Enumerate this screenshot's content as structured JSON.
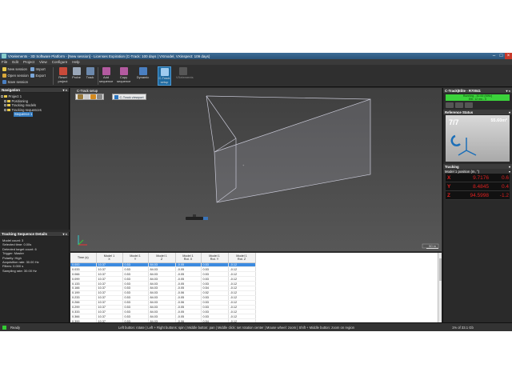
{
  "window": {
    "title": "VXelements - 3D Software Platform - [New session] - Licenses Expiration (C-Track: 100 days | VXmodel, VXinspect: 109 days)"
  },
  "menu": [
    "File",
    "Edit",
    "Project",
    "View",
    "Configure",
    "Help"
  ],
  "ribbon": {
    "session": [
      "New session",
      "Open session",
      "Save session"
    ],
    "io": [
      "Import",
      "Export"
    ],
    "buttons": [
      {
        "label": "Reset project"
      },
      {
        "label": "Probe"
      },
      {
        "label": "Track"
      },
      {
        "label": "Add sequence"
      },
      {
        "label": "Copy sequence"
      },
      {
        "label": "Dynamic"
      },
      {
        "label": "C-Track setup"
      },
      {
        "label": "VXelements"
      }
    ]
  },
  "navigation": {
    "title": "Navigation",
    "tree": [
      {
        "label": "Project 1",
        "level": 0
      },
      {
        "label": "Positioning",
        "level": 1
      },
      {
        "label": "Tracking models",
        "level": 1
      },
      {
        "label": "Tracking sequences",
        "level": 1
      },
      {
        "label": "Sequence 1",
        "level": 2
      }
    ]
  },
  "details": {
    "title": "Tracking Sequence Details",
    "lines": [
      "Model count: 3",
      "Selected time: 0.00s",
      "Detected target count: 6",
      "Trigger: Master",
      "Polarity: High",
      "Acquisition rate: 30.00 Hz",
      "Filters: 0.000 s",
      "Sampling rate: 30.00 Hz"
    ]
  },
  "viewport": {
    "title": "C-Track setup",
    "selector_label": "C-Track viewport",
    "scale_label": "50 m"
  },
  "table": {
    "headers": [
      "Time (s)",
      "Model 1\nX",
      "Model 1\nY",
      "Model 1\nZ",
      "Model 1\nRot. X",
      "Model 1\nRot. Y",
      "Model 1\nRot. Z"
    ],
    "rows": [
      [
        "0.000",
        "10.37",
        "0.53",
        "84.03",
        "-0.05",
        "0.53",
        "-0.12"
      ],
      [
        "0.033",
        "10.37",
        "0.53",
        "84.03",
        "-0.05",
        "0.53",
        "-0.12"
      ],
      [
        "0.066",
        "10.37",
        "0.53",
        "84.03",
        "-0.05",
        "0.53",
        "-0.12"
      ],
      [
        "0.099",
        "10.37",
        "0.53",
        "84.03",
        "-0.05",
        "0.53",
        "-0.12"
      ],
      [
        "0.133",
        "10.37",
        "0.53",
        "84.03",
        "-0.05",
        "0.53",
        "-0.12"
      ],
      [
        "0.166",
        "10.37",
        "0.53",
        "84.03",
        "-0.05",
        "0.54",
        "-0.12"
      ],
      [
        "0.199",
        "10.37",
        "0.53",
        "84.03",
        "-0.06",
        "0.52",
        "-0.12"
      ],
      [
        "0.233",
        "10.37",
        "0.53",
        "84.03",
        "-0.05",
        "0.53",
        "-0.12"
      ],
      [
        "0.266",
        "10.37",
        "0.53",
        "84.03",
        "-0.06",
        "0.53",
        "-0.12"
      ],
      [
        "0.299",
        "10.37",
        "0.53",
        "84.03",
        "-0.05",
        "0.53",
        "-0.12"
      ],
      [
        "0.333",
        "10.37",
        "0.53",
        "84.03",
        "-0.05",
        "0.53",
        "-0.12"
      ],
      [
        "0.366",
        "10.37",
        "0.53",
        "84.03",
        "-0.05",
        "0.53",
        "-0.12"
      ],
      [
        "0.399",
        "10.37",
        "0.53",
        "84.03",
        "-0.06",
        "0.54",
        "-0.12"
      ],
      [
        "0.433",
        "10.37",
        "0.53",
        "84.03",
        "-0.05",
        "0.53",
        "-0.12"
      ],
      [
        "0.466",
        "10.37",
        "0.53",
        "84.03",
        "-0.05",
        "0.53",
        "-0.12"
      ],
      [
        "0.499",
        "10.37",
        "0.53",
        "84.03",
        "-0.05",
        "0.53",
        "-0.12"
      ],
      [
        "0.533",
        "10.37",
        "0.53",
        "84.03",
        "-0.05",
        "0.53",
        "-0.12"
      ],
      [
        "0.566",
        "10.37",
        "0.53",
        "84.03",
        "-0.05",
        "0.53",
        "-0.12"
      ],
      [
        "0.599",
        "10.37",
        "0.53",
        "84.03",
        "-0.05",
        "0.53",
        "-0.12"
      ],
      [
        "0.633",
        "10.37",
        "0.53",
        "84.03",
        "-0.05",
        "0.53",
        "-0.12"
      ]
    ]
  },
  "right_panel": {
    "ctrack_title": "C-Track|Elite - R70041",
    "status_running": "Running - 30.00 (MHz)",
    "status_detail": "Eth: 12 ms - 0",
    "reference_title": "Reference Status",
    "reference_count": "7/7",
    "reference_angle": "55.60m²",
    "tracking_title": "Tracking",
    "model_position_title": "Model 1 position (m, °)",
    "positions": [
      {
        "axis": "X",
        "value": "9.7176",
        "delta": "0.6"
      },
      {
        "axis": "Y",
        "value": "8.4845",
        "delta": "0.4"
      },
      {
        "axis": "Z",
        "value": "94.5998",
        "delta": "-1.2"
      }
    ]
  },
  "statusbar": {
    "ready": "Ready",
    "hint": "Left button: rotate  |  Left + Right buttons: spin  |  Middle button: pan  |  Middle click: set rotation center  |  Mouse wheel: zoom  |  Shift + Middle button: zoom on region",
    "percent": "1% of 33.1 Gb"
  },
  "colors": {
    "accent": "#2f79c0",
    "running": "#3bd33b",
    "position_text": "#e02020"
  }
}
